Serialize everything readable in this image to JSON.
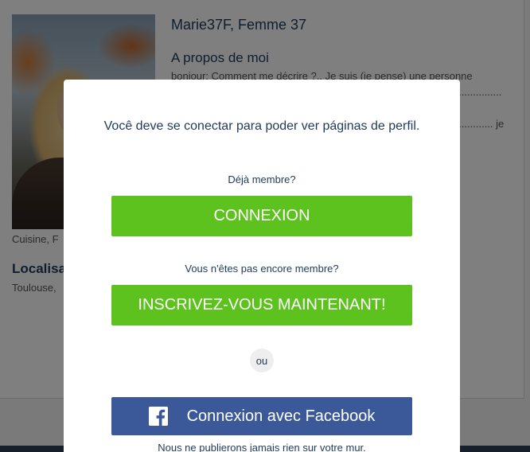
{
  "profile": {
    "name_line": "Marie37F, Femme 37",
    "about_heading": "A propos de moi",
    "about_text": "bonjour; Comment me décrire ?.. Je suis (je pense) une personne ...................................................... e, ........................................................ ye d¿en ..................................................... temps ..................................................... en ..................................................... je ..................................................... très",
    "photo_caption": "Cuisine, F",
    "location_heading": "Localisa",
    "location_value": "Toulouse,"
  },
  "modal": {
    "message": "Você deve se conectar para poder ver páginas de perfil.",
    "member_prompt": "Déjà membre?",
    "login_button": "CONNEXION",
    "not_member_prompt": "Vous n'êtes pas encore membre?",
    "signup_button": "INSCRIVEZ-VOUS MAINTENANT!",
    "or_label": "ou",
    "facebook_button": "Connexion avec Facebook",
    "facebook_disclaimer": "Nous ne publierons jamais rien sur votre mur."
  },
  "icons": {
    "facebook": "facebook-icon"
  },
  "colors": {
    "primary_green": "#5dc21e",
    "facebook_blue": "#3b5998",
    "text_navy": "#1e3a5a"
  }
}
